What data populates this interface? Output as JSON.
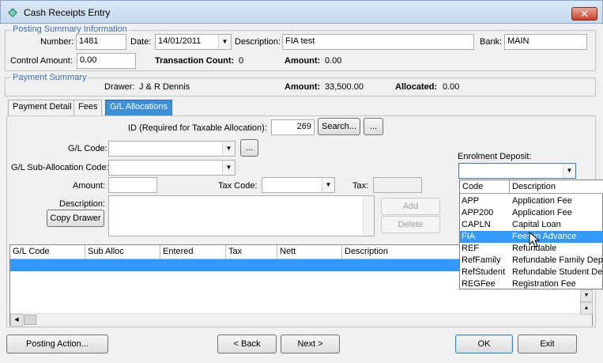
{
  "window": {
    "title": "Cash Receipts Entry",
    "close_label": "✕"
  },
  "posting": {
    "legend": "Posting Summary Information",
    "number_label": "Number:",
    "number": "1481",
    "date_label": "Date:",
    "date": "14/01/2011",
    "description_label": "Description:",
    "description": "FIA test",
    "bank_label": "Bank:",
    "bank": "MAIN",
    "control_label": "Control Amount:",
    "control": "0.00",
    "txn_count_label": "Transaction Count:",
    "txn_count": "0",
    "amount_label": "Amount:",
    "amount": "0.00"
  },
  "payment": {
    "legend": "Payment Summary",
    "drawer_label": "Drawer:",
    "drawer": "J & R Dennis",
    "amount_label": "Amount:",
    "amount": "33,500.00",
    "allocated_label": "Allocated:",
    "allocated": "0.00"
  },
  "tabs": [
    "Payment Detail",
    "Fees",
    "G/L Allocations"
  ],
  "alloc": {
    "id_label": "ID (Required for Taxable Allocation):",
    "id": "269",
    "search": "Search...",
    "ellipsis": "...",
    "gl_code_label": "G/L Code:",
    "gl_sub_label": "G/L Sub-Allocation Code:",
    "amount_label": "Amount:",
    "tax_code_label": "Tax Code:",
    "tax_label": "Tax:",
    "description_label": "Description:",
    "copy_drawer": "Copy Drawer",
    "add": "Add",
    "delete": "Delete",
    "enrolment_label": "Enrolment Deposit:"
  },
  "grid": {
    "columns": [
      "G/L Code",
      "Sub Alloc",
      "Entered",
      "Tax",
      "Nett",
      "Description"
    ]
  },
  "dropdown": {
    "columns": [
      "Code",
      "Description"
    ],
    "rows": [
      {
        "code": "APP",
        "desc": "Application Fee"
      },
      {
        "code": "APP200",
        "desc": "Application Fee"
      },
      {
        "code": "CAPLN",
        "desc": "Capital Loan"
      },
      {
        "code": "FIA",
        "desc": "Fees in Advance"
      },
      {
        "code": "REF",
        "desc": "Refundable"
      },
      {
        "code": "RefFamily",
        "desc": "Refundable Family Depo"
      },
      {
        "code": "RefStudent",
        "desc": "Refundable Student Dep"
      },
      {
        "code": "REGFee",
        "desc": "Registration Fee"
      }
    ],
    "selected_index": 3
  },
  "footer": {
    "posting_action": "Posting Action...",
    "back": "< Back",
    "next": "Next >",
    "ok": "OK",
    "exit": "Exit"
  },
  "colors": {
    "accent": "#3399ff",
    "legend": "#3b6fb6",
    "tab_active": "#3d8fd6"
  }
}
